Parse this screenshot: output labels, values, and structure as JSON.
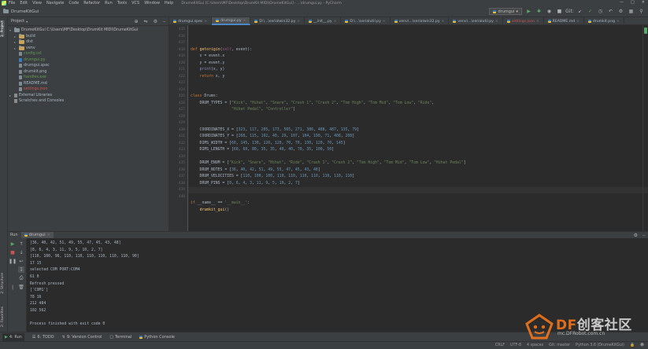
{
  "window": {
    "title": "DrumeKitGui [C:\\Users\\MF\\Desktop\\DrumKit MIDI\\DrumeKitGui] - ...\\drumgui.py - PyCharm",
    "menu": [
      "File",
      "Edit",
      "View",
      "Navigate",
      "Code",
      "Refactor",
      "Run",
      "Tools",
      "VCS",
      "Window",
      "Help"
    ]
  },
  "navbar": {
    "project_name": "DrumeKitGui",
    "run_config": "drumgui",
    "vcs_label": "Git:"
  },
  "project_panel": {
    "title": "Project",
    "root": "DrumeKitGui  C:\\Users\\MF\\Desktop\\DrumKit MIDI\\DrumeKitGui",
    "items": [
      {
        "label": "build",
        "type": "folder",
        "color": "#a9b7c6"
      },
      {
        "label": "dist",
        "type": "folder",
        "color": "#a9b7c6"
      },
      {
        "label": "venv",
        "type": "folder",
        "color": "#a9b7c6"
      },
      {
        "label": "config.txt",
        "type": "file",
        "color": "#629755"
      },
      {
        "label": "drumgui.py",
        "type": "file",
        "color": "#629755"
      },
      {
        "label": "drumgui.spec",
        "type": "file",
        "color": "#a9b7c6"
      },
      {
        "label": "drumkit.png",
        "type": "file",
        "color": "#a9b7c6"
      },
      {
        "label": "handles.exe",
        "type": "file",
        "color": "#629755"
      },
      {
        "label": "README.md",
        "type": "file",
        "color": "#a9b7c6"
      },
      {
        "label": "settings.json",
        "type": "file",
        "color": "#c75450"
      }
    ],
    "external": "External Libraries",
    "scratches": "Scratches and Consoles"
  },
  "tabs": [
    {
      "label": "drumgui.spec",
      "active": false
    },
    {
      "label": "drumgui.py",
      "active": true
    },
    {
      "label": "D:\\...\\serialwin32.py",
      "active": false
    },
    {
      "label": "__init__.py",
      "active": false
    },
    {
      "label": "D:\\...\\serialutil.py",
      "active": false
    },
    {
      "label": "venv\\...\\serialwin32.py",
      "active": false
    },
    {
      "label": "venv\\...\\serialutil.py",
      "active": false
    },
    {
      "label": "settings.json",
      "active": false
    },
    {
      "label": "README.md",
      "active": false
    },
    {
      "label": "drumkit.png",
      "active": false
    }
  ],
  "editor": {
    "line_numbers": [
      "415",
      "416",
      "417",
      "418",
      "419",
      "420",
      "421",
      "422",
      "423",
      "424",
      "425",
      "426",
      "427",
      "428",
      "429",
      "430",
      "431",
      "432",
      "433",
      "434",
      "435",
      "436",
      "437",
      "438",
      "439",
      "440"
    ],
    "lines": [
      "",
      "",
      "",
      "def getorigin(self, event):",
      "    x = event.x",
      "    y = event.y",
      "    print(x, y)",
      "    return x, y",
      "",
      "",
      "class Drums:",
      "    DRUM_TYPES = [\"Kick\", \"Hihat\", \"Snare\", \"Crash 1\", \"Crash 2\", \"Tom High\", \"Tom Mid\", \"Tom Low\", \"Ride\",",
      "                  \"Hihat Pedal\", \"Controller\"]",
      "",
      "",
      "    COORDINATES_X = [323, 117, 205, 173, 565, 271, 386, 488, 487, 135, 79]",
      "    COORDINATES_Y = [268, 115, 192, 40, 29, 107, 104, 190, 71, 408, 208]",
      "    DIMS_WIDTH = [60, 145, 130, 120, 120, 70, 70, 130, 120, 70, 145]",
      "    DIMS_LENGTH = [60, 60, 80, 35, 35, 40, 40, 70, 35, 100, 50]",
      "",
      "    DRUM_ENUM = [\"Kick\", \"Snare\", \"Hihat\", \"Ride\", \"Crash 1\", \"Crash 2\", \"Tom High\", \"Tom Mid\", \"Tom Low\", \"Hihat Pedal\"]",
      "    DRUM_NOTES = [36, 40, 42, 51, 49, 55, 47, 45, 43, 48]",
      "    DRUM_VELOCITIES = [110, 100, 100, 110, 110, 110, 110, 110, 110, 110]",
      "    DRUM_PINS = [8, 6, 4, 3, 11, 9, 5, 10, 2, 7]",
      "",
      "",
      "if __name__ == '__main__':",
      "    drumkit_gui()"
    ]
  },
  "run_panel": {
    "title": "Run",
    "tab": "drumgui",
    "output": [
      "[36, 40, 42, 51, 49, 55, 47, 45, 43, 48]",
      "[8, 6, 4, 3, 11, 9, 5, 10, 2, 7]",
      "[110, 100, 96, 110, 110, 110, 110, 110, 110, 90]",
      "17 15",
      "selected COM PORT:COM4",
      "61 0",
      "Refresh pressed",
      "['COM1']",
      "78 16",
      "212 484",
      "102 562",
      "",
      "Process finished with exit code 0"
    ]
  },
  "side_tabs": {
    "project": "1: Project",
    "structure": "2: Structure",
    "favorites": "2: Favorites"
  },
  "bottom_tools": [
    "4: Run",
    "6: TODO",
    "9: Version Control",
    "Terminal",
    "Python Console"
  ],
  "status": {
    "line_sep": "CRLF",
    "encoding": "UTF-8",
    "indent": "4 spaces",
    "branch": "Git: master",
    "interpreter": "Python 3.6 (DrumeKitGui)"
  },
  "watermark": {
    "df": "DF",
    "text": "创客社区",
    "url": "mc.DFRobot.com.cn"
  },
  "colors": {
    "accent": "#4a88c7",
    "run_green": "#59a869",
    "watermark_orange": "#ff7a1a"
  }
}
